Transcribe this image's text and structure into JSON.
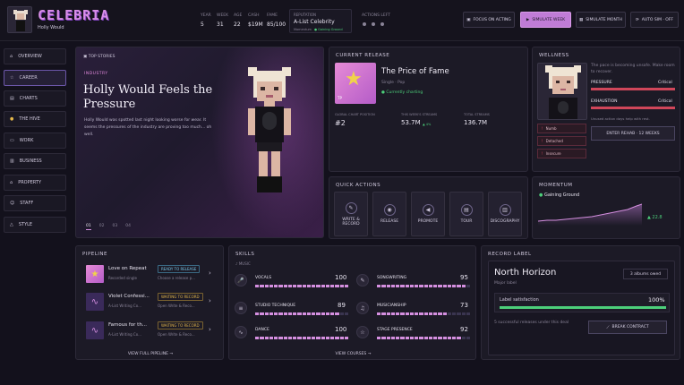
{
  "header": {
    "logo": "CELEBRIA",
    "player_name": "Holly Would",
    "stats": [
      {
        "label": "YEAR",
        "value": "5"
      },
      {
        "label": "WEEK",
        "value": "31"
      },
      {
        "label": "AGE",
        "value": "22"
      },
      {
        "label": "CASH",
        "value": "$19M"
      },
      {
        "label": "FAME",
        "value": "85/100"
      }
    ],
    "reputation_label": "REPUTATION",
    "reputation_value": "A-List Celebrity",
    "reputation_sub": "Momentum",
    "reputation_status": "Gaining Ground",
    "actions_left_label": "ACTIONS LEFT",
    "buttons": {
      "focus": "FOCUS ON ACTING",
      "simulate_week": "SIMULATE WEEK",
      "simulate_month": "SIMULATE MONTH",
      "auto_sim": "AUTO SIM · OFF"
    }
  },
  "sidebar": {
    "items": [
      {
        "label": "OVERVIEW",
        "icon": "home-icon"
      },
      {
        "label": "CAREER",
        "icon": "star-icon"
      },
      {
        "label": "CHARTS",
        "icon": "chart-icon"
      },
      {
        "label": "THE HIVE",
        "icon": "hive-icon"
      },
      {
        "label": "WORK",
        "icon": "briefcase-icon"
      },
      {
        "label": "BUSINESS",
        "icon": "building-icon"
      },
      {
        "label": "PROPERTY",
        "icon": "house-icon"
      },
      {
        "label": "STAFF",
        "icon": "people-icon"
      },
      {
        "label": "STYLE",
        "icon": "hanger-icon"
      }
    ],
    "active": "CAREER"
  },
  "stories": {
    "label": "TOP STORIES",
    "category": "INDUSTRY",
    "headline": "Holly Would Feels the Pressure",
    "body": "Holly Would was spotted last night looking worse for wear. It seems the pressures of the industry are proving too much... oh well.",
    "pages": [
      "01",
      "02",
      "03",
      "04"
    ]
  },
  "release": {
    "title": "CURRENT RELEASE",
    "name": "The Price of Fame",
    "meta": "Single · Pop",
    "status": "Currently charting",
    "cover_initials": "TP",
    "stats": [
      {
        "label": "GLOBAL CHART POSITION",
        "value": "#2",
        "delta": ""
      },
      {
        "label": "THIS WEEK'S STREAMS",
        "value": "53.7M",
        "delta": "▲ 4%"
      },
      {
        "label": "TOTAL STREAMS",
        "value": "136.7M",
        "delta": ""
      }
    ]
  },
  "wellness": {
    "title": "WELLNESS",
    "note": "The pace is becoming unsafe. Make room to recover.",
    "pressure_label": "PRESSURE",
    "pressure_value": "Critical",
    "pressure_level": 1.0,
    "exhaustion_label": "EXHAUSTION",
    "exhaustion_value": "Critical",
    "exhaustion_level": 1.0,
    "hint": "Unused action days help with rest.",
    "conditions": [
      "Numb",
      "Detached",
      "Insecure"
    ],
    "rehab_button": "ENTER REHAB · 12 WEEKS"
  },
  "quick_actions": {
    "title": "QUICK ACTIONS",
    "items": [
      {
        "label": "WRITE & RECORD",
        "icon": "pen-icon"
      },
      {
        "label": "RELEASE",
        "icon": "disc-icon"
      },
      {
        "label": "PROMOTE",
        "icon": "megaphone-icon"
      },
      {
        "label": "TOUR",
        "icon": "ticket-icon"
      },
      {
        "label": "DISCOGRAPHY",
        "icon": "library-icon"
      }
    ]
  },
  "momentum": {
    "title": "MOMENTUM",
    "status": "Gaining Ground",
    "value": "▲ 22.8"
  },
  "pipeline": {
    "title": "PIPELINE",
    "items": [
      {
        "name": "Love on Repeat",
        "sub": "Recorded single",
        "tag": "READY TO RELEASE",
        "action": "Choose a release p..."
      },
      {
        "name": "Violet Confessi...",
        "sub": "A-List Writing Co...",
        "tag": "WAITING TO RECORD",
        "action": "Open Write & Reco..."
      },
      {
        "name": "Famous for th...",
        "sub": "A-List Writing Co...",
        "tag": "WAITING TO RECORD",
        "action": "Open Write & Reco..."
      }
    ],
    "footer": "VIEW FULL PIPELINE →"
  },
  "skills": {
    "title": "SKILLS",
    "section": "MUSIC",
    "items": [
      {
        "label": "VOCALS",
        "value": 100,
        "icon": "mic-icon"
      },
      {
        "label": "SONGWRITING",
        "value": 95,
        "icon": "pencil-icon"
      },
      {
        "label": "STUDIO TECHNIQUE",
        "value": 89,
        "icon": "sliders-icon"
      },
      {
        "label": "MUSICIANSHIP",
        "value": 73,
        "icon": "guitar-icon"
      },
      {
        "label": "DANCE",
        "value": 100,
        "icon": "dance-icon"
      },
      {
        "label": "STAGE PRESENCE",
        "value": 92,
        "icon": "star-icon"
      }
    ],
    "footer": "VIEW COURSES →"
  },
  "label": {
    "title": "RECORD LABEL",
    "name": "North Horizon",
    "type": "Major label",
    "badge": "3 albums owed",
    "satisfaction_label": "Label satisfaction",
    "satisfaction_value": "100%",
    "satisfaction_level": 1.0,
    "note": "5 successful releases under this deal",
    "break_button": "BREAK CONTRACT"
  },
  "colors": {
    "accent": "#d58fe0",
    "green": "#4ccf7a",
    "critical": "#d0465a"
  }
}
